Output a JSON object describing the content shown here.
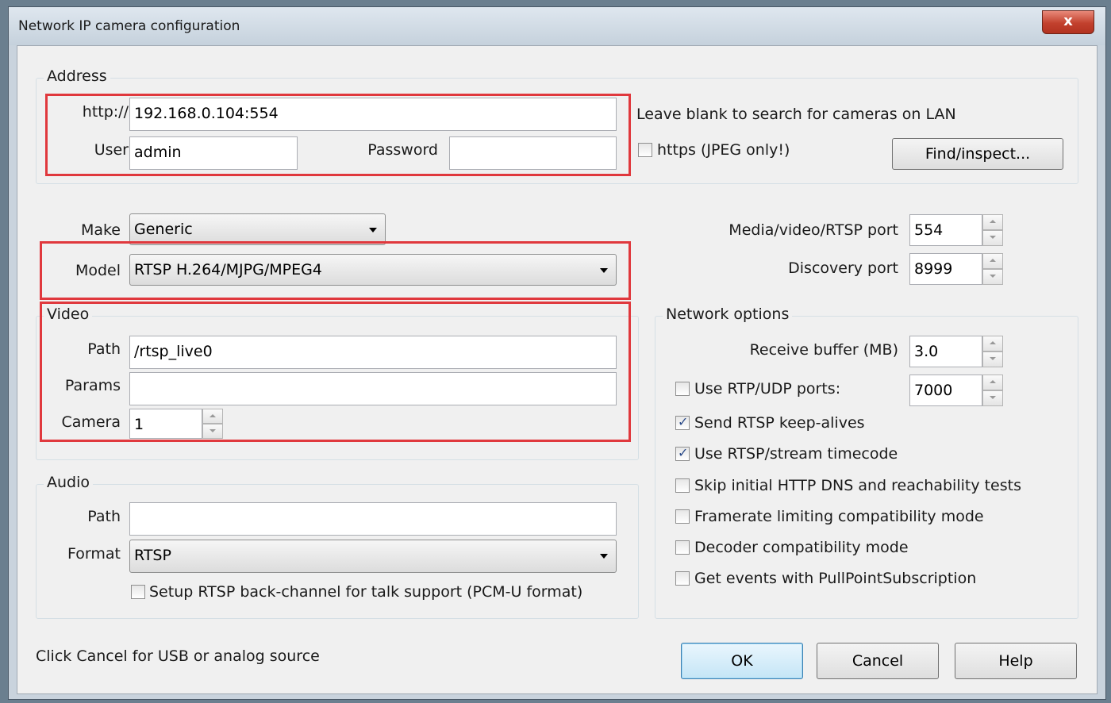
{
  "window": {
    "title": "Network IP camera configuration",
    "close_label": "x"
  },
  "address": {
    "legend": "Address",
    "url_prefix": "http://",
    "url_value": "192.168.0.104:554",
    "user_label": "User",
    "user_value": "admin",
    "password_label": "Password",
    "password_value": "",
    "hint": "Leave blank to search for cameras on LAN",
    "https_label": "https (JPEG only!)",
    "https_checked": false,
    "find_button": "Find/inspect..."
  },
  "device": {
    "make_label": "Make",
    "make_value": "Generic",
    "model_label": "Model",
    "model_value": "RTSP H.264/MJPG/MPEG4",
    "media_port_label": "Media/video/RTSP port",
    "media_port_value": "554",
    "discovery_port_label": "Discovery port",
    "discovery_port_value": "8999"
  },
  "video": {
    "legend": "Video",
    "path_label": "Path",
    "path_value": "/rtsp_live0",
    "params_label": "Params",
    "params_value": "",
    "camera_label": "Camera",
    "camera_value": "1"
  },
  "audio": {
    "legend": "Audio",
    "path_label": "Path",
    "path_value": "",
    "format_label": "Format",
    "format_value": "RTSP",
    "backchannel_label": "Setup RTSP back-channel for talk support (PCM-U format)",
    "backchannel_checked": false
  },
  "network": {
    "legend": "Network options",
    "receive_buffer_label": "Receive buffer (MB)",
    "receive_buffer_value": "3.0",
    "rtp_udp_label": "Use RTP/UDP ports:",
    "rtp_udp_checked": false,
    "rtp_udp_value": "7000",
    "options": [
      {
        "label": "Send RTSP keep-alives",
        "checked": true
      },
      {
        "label": "Use RTSP/stream timecode",
        "checked": true
      },
      {
        "label": "Skip initial HTTP DNS and reachability tests",
        "checked": false
      },
      {
        "label": "Framerate limiting compatibility mode",
        "checked": false
      },
      {
        "label": "Decoder compatibility mode",
        "checked": false
      },
      {
        "label": "Get events with PullPointSubscription",
        "checked": false
      }
    ]
  },
  "footer": {
    "hint": "Click Cancel for USB or analog source",
    "ok": "OK",
    "cancel": "Cancel",
    "help": "Help"
  },
  "colors": {
    "highlight": "#e0383d",
    "dialog_bg": "#f0f0f0",
    "default_button": "#c4e5f6"
  }
}
